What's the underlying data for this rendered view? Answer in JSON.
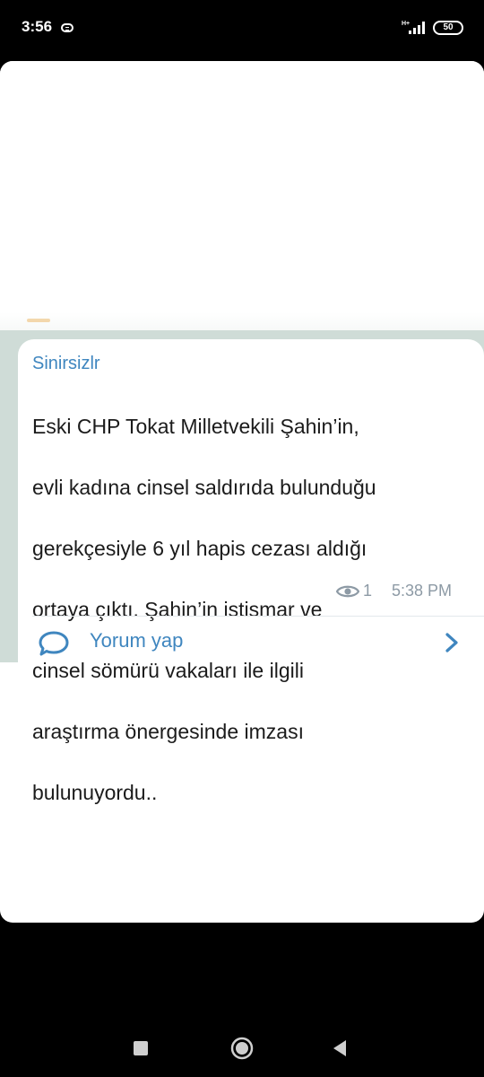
{
  "status_bar": {
    "time": "3:56",
    "network": "H+",
    "battery": "50"
  },
  "message": {
    "sender": "Sinirsizlr",
    "lines": [
      "Eski CHP Tokat Milletvekili Şahin’in,",
      "evli kadına cinsel saldırıda bulunduğu",
      "gerekçesiyle 6 yıl hapis cezası aldığı",
      "ortaya çıktı. Şahin’in istismar ve",
      "cinsel sömürü vakaları ile ilgili",
      "araştırma önergesinde imzası",
      "bulunuyordu.."
    ],
    "views": "1",
    "time": "5:38 PM"
  },
  "comment": {
    "label": "Yorum yap"
  },
  "colors": {
    "accent": "#3f86bf",
    "wallpaper": "#cfdcd7",
    "meta": "#8d9aa5"
  },
  "icons": {
    "notification": "notification-icon",
    "signal": "signal-icon",
    "battery": "battery-icon",
    "views": "eye-icon",
    "comment": "comment-bubble-icon",
    "chevron": "chevron-right-icon",
    "nav_recent": "recent-apps-icon",
    "nav_home": "home-icon",
    "nav_back": "back-icon"
  }
}
